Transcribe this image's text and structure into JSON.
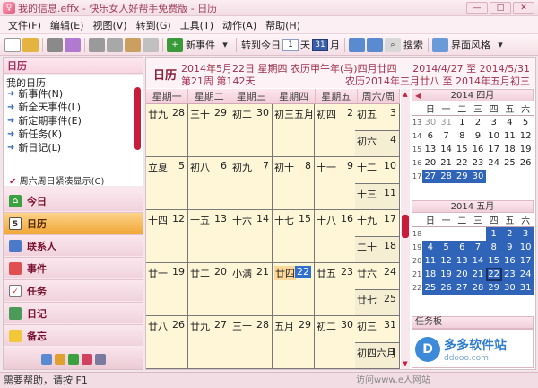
{
  "window": {
    "title": "我的信息.effx - 快乐女人好帮手免费版 - 日历",
    "min": "—",
    "max": "□",
    "close": "✕"
  },
  "menu": [
    "文件(F)",
    "编辑(E)",
    "视图(V)",
    "转到(G)",
    "工具(T)",
    "动作(A)",
    "帮助(H)"
  ],
  "toolbar": {
    "new_event": "新事件",
    "goto_today": "转到今日",
    "day": "天",
    "month": "月",
    "search": "搜索",
    "theme": "界面风格"
  },
  "left": {
    "header": "日历",
    "sub": "我的日历",
    "items": [
      "新事件(N)",
      "新全天事件(L)",
      "新定期事件(E)",
      "新任务(K)",
      "新日记(L)"
    ],
    "show": "周六周日紧凑显示(C)"
  },
  "nav": [
    {
      "label": "今日",
      "icon": "home-icon"
    },
    {
      "label": "日历",
      "icon": "calendar-icon"
    },
    {
      "label": "联系人",
      "icon": "contacts-icon"
    },
    {
      "label": "事件",
      "icon": "event-icon"
    },
    {
      "label": "任务",
      "icon": "task-icon"
    },
    {
      "label": "日记",
      "icon": "diary-icon"
    },
    {
      "label": "备忘",
      "icon": "memo-icon"
    }
  ],
  "main": {
    "title": "日历",
    "date_line1": "2014年5月22日 星期四 农历甲午年(马)四月廿四",
    "date_line2": "第21周 第142天",
    "range_line1": "2014/4/27 至 2014/5/31",
    "range_line2": "农历2014年三月廿八 至 2014年五月初三",
    "weekdays": [
      "星期一",
      "星期二",
      "星期三",
      "星期四",
      "星期五",
      "周六/周日"
    ],
    "weeks": [
      [
        {
          "l": "廿九",
          "s": "28"
        },
        {
          "l": "三十",
          "s": "29"
        },
        {
          "l": "初二",
          "s": "30"
        },
        {
          "l": "初三五月",
          "s": "1"
        },
        {
          "l": "初四",
          "s": "2"
        }
      ],
      [
        {
          "l": "立夏",
          "s": "5"
        },
        {
          "l": "初八",
          "s": "6"
        },
        {
          "l": "初九",
          "s": "7"
        },
        {
          "l": "初十",
          "s": "8"
        },
        {
          "l": "十一",
          "s": "9"
        }
      ],
      [
        {
          "l": "十四",
          "s": "12"
        },
        {
          "l": "十五",
          "s": "13"
        },
        {
          "l": "十六",
          "s": "14"
        },
        {
          "l": "十七",
          "s": "15"
        },
        {
          "l": "十八",
          "s": "16"
        }
      ],
      [
        {
          "l": "廿一",
          "s": "19"
        },
        {
          "l": "廿二",
          "s": "20"
        },
        {
          "l": "小满",
          "s": "21"
        },
        {
          "l": "廿四",
          "s": "22"
        },
        {
          "l": "廿五",
          "s": "23"
        }
      ],
      [
        {
          "l": "廿八",
          "s": "26"
        },
        {
          "l": "廿九",
          "s": "27"
        },
        {
          "l": "三十",
          "s": "28"
        },
        {
          "l": "五月",
          "s": "29"
        },
        {
          "l": "初二",
          "s": "30"
        }
      ]
    ],
    "weekend": [
      {
        "l": "初五",
        "s": "3"
      },
      {
        "l": "初六",
        "s": "4"
      },
      {
        "l": "十二",
        "s": "10"
      },
      {
        "l": "十三",
        "s": "11"
      },
      {
        "l": "十九",
        "s": "17"
      },
      {
        "l": "二十",
        "s": "18"
      },
      {
        "l": "廿六",
        "s": "24"
      },
      {
        "l": "廿七",
        "s": "25"
      },
      {
        "l": "初三",
        "s": "31"
      },
      {
        "l": "初四六月",
        "s": "1"
      }
    ]
  },
  "mini_april": {
    "title": "2014 四月",
    "head": [
      "日",
      "一",
      "二",
      "三",
      "四",
      "五",
      "六"
    ],
    "rows": [
      {
        "wk": "13",
        "d": [
          "30",
          "31",
          "1",
          "2",
          "3",
          "4",
          "5"
        ]
      },
      {
        "wk": "14",
        "d": [
          "6",
          "7",
          "8",
          "9",
          "10",
          "11",
          "12"
        ]
      },
      {
        "wk": "15",
        "d": [
          "13",
          "14",
          "15",
          "16",
          "17",
          "18",
          "19"
        ]
      },
      {
        "wk": "16",
        "d": [
          "20",
          "21",
          "22",
          "23",
          "24",
          "25",
          "26"
        ]
      },
      {
        "wk": "17",
        "d": [
          "27",
          "28",
          "29",
          "30",
          "",
          "",
          ""
        ]
      }
    ]
  },
  "mini_may": {
    "title": "2014 五月",
    "head": [
      "日",
      "一",
      "二",
      "三",
      "四",
      "五",
      "六"
    ],
    "rows": [
      {
        "wk": "18",
        "d": [
          "",
          "",
          "",
          "",
          "1",
          "2",
          "3"
        ]
      },
      {
        "wk": "19",
        "d": [
          "4",
          "5",
          "6",
          "7",
          "8",
          "9",
          "10"
        ]
      },
      {
        "wk": "20",
        "d": [
          "11",
          "12",
          "13",
          "14",
          "15",
          "16",
          "17"
        ]
      },
      {
        "wk": "21",
        "d": [
          "18",
          "19",
          "20",
          "21",
          "22",
          "23",
          "24"
        ]
      },
      {
        "wk": "22",
        "d": [
          "25",
          "26",
          "27",
          "28",
          "29",
          "30",
          "31"
        ]
      }
    ]
  },
  "tasks": {
    "header": "任务板"
  },
  "status": {
    "help": "需要帮助，请按 F1",
    "right": "访问www.e人网站"
  },
  "watermark": {
    "brand": "多多软件站",
    "url": "ddooo.com"
  }
}
